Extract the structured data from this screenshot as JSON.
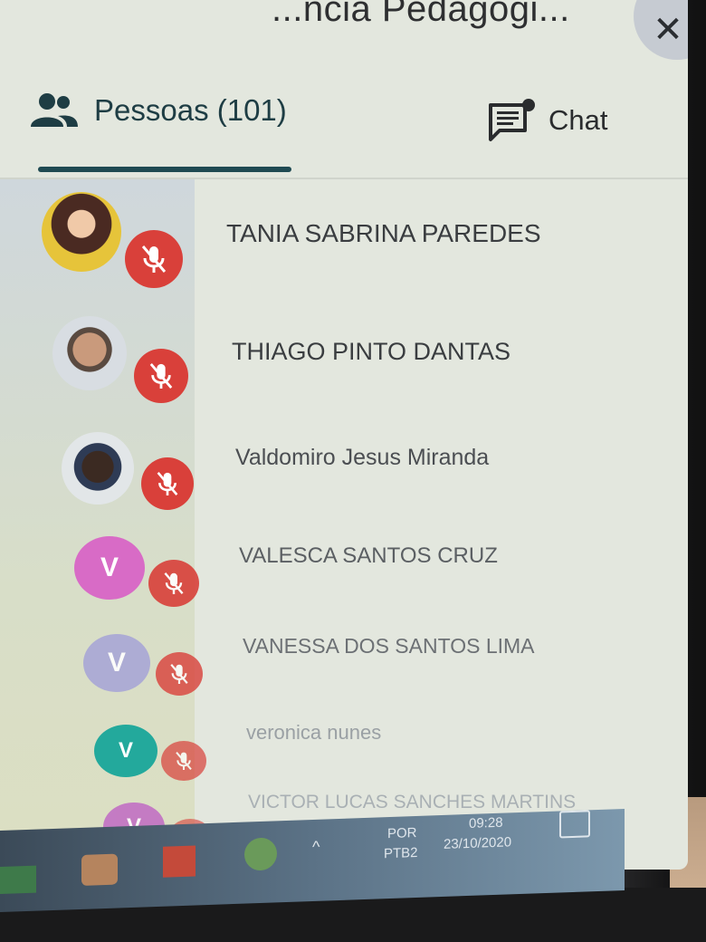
{
  "header": {
    "title": "...ncia Pedagógi...",
    "close_glyph": "✕"
  },
  "tabs": {
    "people_label": "Pessoas (101)",
    "chat_label": "Chat",
    "people_icon": "people-icon",
    "chat_icon": "chat-icon"
  },
  "participants": [
    {
      "name": "TANIA SABRINA PAREDES",
      "avatar": "photo",
      "muted": true
    },
    {
      "name": "THIAGO PINTO DANTAS",
      "avatar": "photo",
      "muted": true
    },
    {
      "name": "Valdomiro Jesus Miranda",
      "avatar": "photo",
      "muted": true
    },
    {
      "name": "VALESCA SANTOS CRUZ",
      "avatar": "V",
      "avatar_color": "#d86bc6",
      "muted": true
    },
    {
      "name": "VANESSA DOS SANTOS LIMA",
      "avatar": "V",
      "avatar_color": "#a9a7d6",
      "muted": true
    },
    {
      "name": "veronica nunes",
      "avatar": "V",
      "avatar_color": "#23a99c",
      "muted": true
    },
    {
      "name": "VICTOR LUCAS SANCHES MARTINS",
      "avatar": "V",
      "avatar_color": "#c06ac4",
      "muted": true
    }
  ],
  "taskbar": {
    "language_line1": "POR",
    "language_line2": "PTB2",
    "time": "09:28",
    "date": "23/10/2020"
  },
  "colors": {
    "mute_red": "#d9403a",
    "tab_active": "#1f4a52"
  }
}
